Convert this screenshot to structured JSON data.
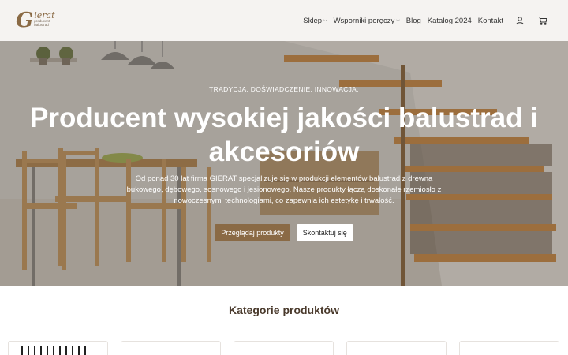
{
  "header": {
    "logo": {
      "mark": "G",
      "name": "ierat",
      "sub_line1": "producent",
      "sub_line2": "balustrad"
    },
    "nav": [
      {
        "label": "Sklep",
        "has_dropdown": true
      },
      {
        "label": "Wsporniki poręczy",
        "has_dropdown": true
      },
      {
        "label": "Blog",
        "has_dropdown": false
      },
      {
        "label": "Katalog 2024",
        "has_dropdown": false
      },
      {
        "label": "Kontakt",
        "has_dropdown": false
      }
    ],
    "icons": [
      "user-icon",
      "cart-icon"
    ]
  },
  "hero": {
    "tagline": "TRADYCJA. DOŚWIADCZENIE. INNOWACJA.",
    "title": "Producent wysokiej jakości balustrad i akcesoriów",
    "description": "Od ponad 30 lat firma GIERAT specjalizuje się w produkcji elementów balustrad z drewna bukowego, dębowego, sosnowego i jesionowego. Nasze produkty łączą doskonałe rzemiosło z nowoczesnymi technologiami, co zapewnia ich estetykę i trwałość.",
    "primary_button": "Przeglądaj produkty",
    "secondary_button": "Skontaktuj się"
  },
  "categories": {
    "title": "Kategorie produktów",
    "card_count": 5
  },
  "colors": {
    "brand": "#8a6a45",
    "header_bg": "#f5f3f1"
  }
}
